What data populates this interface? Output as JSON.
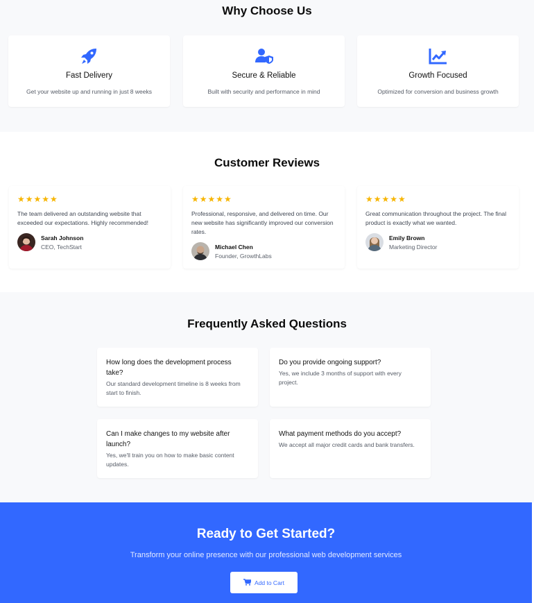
{
  "why_choose_us": {
    "heading": "Why Choose Us",
    "features": [
      {
        "icon": "rocket-icon",
        "title": "Fast Delivery",
        "description": "Get your website up and running in just 8 weeks"
      },
      {
        "icon": "user-shield-icon",
        "title": "Secure & Reliable",
        "description": "Built with security and performance in mind"
      },
      {
        "icon": "chart-line-icon",
        "title": "Growth Focused",
        "description": "Optimized for conversion and business growth"
      }
    ]
  },
  "reviews": {
    "heading": "Customer Reviews",
    "items": [
      {
        "stars": "★★★★★",
        "rating": 5,
        "text": "The team delivered an outstanding website that exceeded our expectations. Highly recommended!",
        "name": "Sarah Johnson",
        "role": "CEO, TechStart"
      },
      {
        "stars": "★★★★★",
        "rating": 5,
        "text": "Professional, responsive, and delivered on time. Our new website has significantly improved our conversion rates.",
        "name": "Michael Chen",
        "role": "Founder, GrowthLabs"
      },
      {
        "stars": "★★★★★",
        "rating": 5,
        "text": "Great communication throughout the project. The final product is exactly what we wanted.",
        "name": "Emily Brown",
        "role": "Marketing Director"
      }
    ]
  },
  "faq": {
    "heading": "Frequently Asked Questions",
    "items": [
      {
        "question": "How long does the development process take?",
        "answer": "Our standard development timeline is 8 weeks from start to finish."
      },
      {
        "question": "Do you provide ongoing support?",
        "answer": "Yes, we include 3 months of support with every project."
      },
      {
        "question": "Can I make changes to my website after launch?",
        "answer": "Yes, we'll train you on how to make basic content updates."
      },
      {
        "question": "What payment methods do you accept?",
        "answer": "We accept all major credit cards and bank transfers."
      }
    ]
  },
  "cta": {
    "heading": "Ready to Get Started?",
    "subheading": "Transform your online presence with our professional web development services",
    "button_label": "Add to Cart",
    "button_icon": "cart-icon"
  },
  "colors": {
    "accent": "#3268ff",
    "star": "#f7b500",
    "section_gray": "#f8f9fb"
  }
}
